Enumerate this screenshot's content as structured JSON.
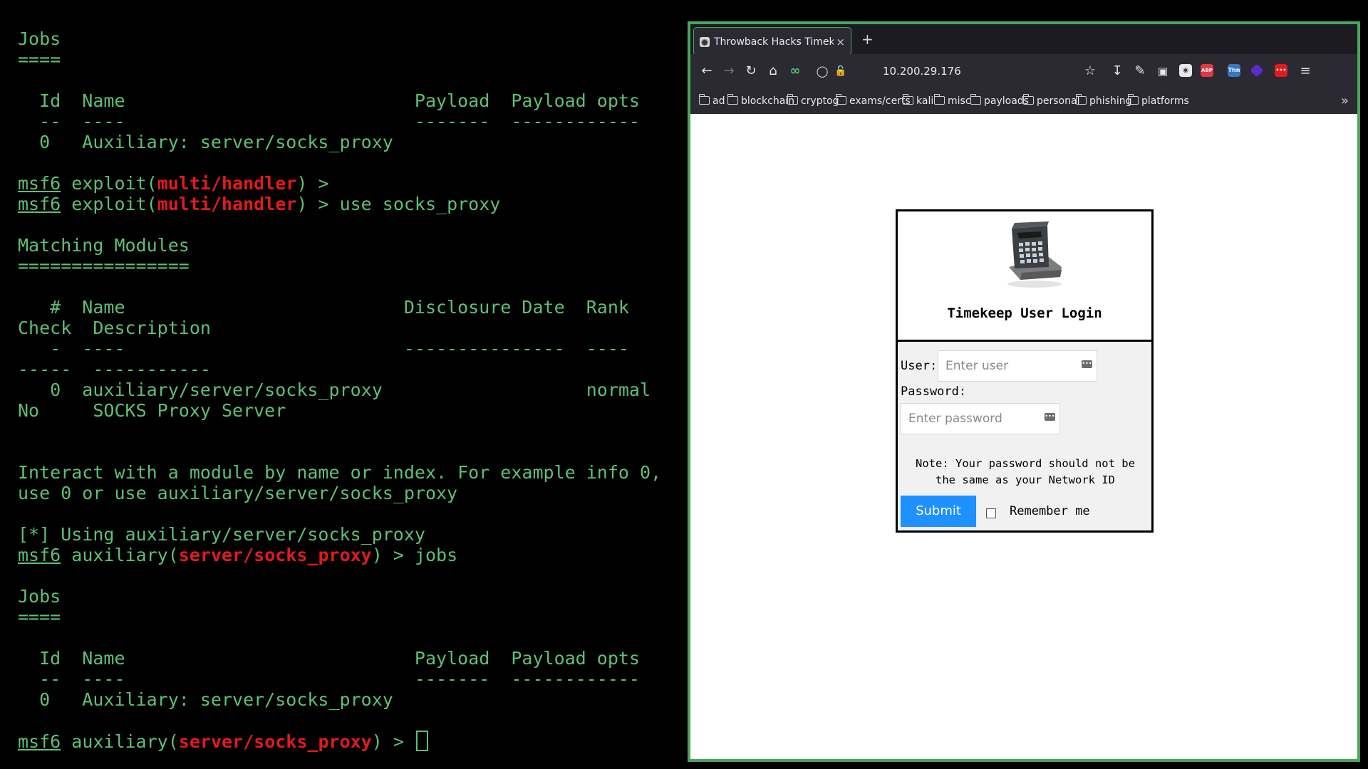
{
  "terminal": {
    "lines": [
      [
        {
          "t": "Jobs"
        }
      ],
      [
        {
          "t": "===="
        }
      ],
      [
        {
          "t": ""
        }
      ],
      [
        {
          "t": "  Id  Name                           Payload  Payload opts"
        }
      ],
      [
        {
          "t": "  --  ----                           -------  ------------"
        }
      ],
      [
        {
          "t": "  0   Auxiliary: server/socks_proxy"
        }
      ],
      [
        {
          "t": ""
        }
      ],
      [
        {
          "t": "msf6",
          "s": "ul"
        },
        {
          "t": " exploit("
        },
        {
          "t": "multi/handler",
          "s": "red"
        },
        {
          "t": ") >"
        }
      ],
      [
        {
          "t": "msf6",
          "s": "ul"
        },
        {
          "t": " exploit("
        },
        {
          "t": "multi/handler",
          "s": "red"
        },
        {
          "t": ") > use socks_proxy"
        }
      ],
      [
        {
          "t": ""
        }
      ],
      [
        {
          "t": "Matching Modules"
        }
      ],
      [
        {
          "t": "================"
        }
      ],
      [
        {
          "t": ""
        }
      ],
      [
        {
          "t": "   #  Name                          Disclosure Date  Rank"
        }
      ],
      [
        {
          "t": "Check  Description"
        }
      ],
      [
        {
          "t": "   -  ----                          ---------------  ----"
        }
      ],
      [
        {
          "t": "-----  -----------"
        }
      ],
      [
        {
          "t": "   0  auxiliary/server/socks_proxy                   normal"
        }
      ],
      [
        {
          "t": "No     SOCKS Proxy Server"
        }
      ],
      [
        {
          "t": ""
        }
      ],
      [
        {
          "t": ""
        }
      ],
      [
        {
          "t": "Interact with a module by name or index. For example info 0,"
        }
      ],
      [
        {
          "t": "use 0 or use auxiliary/server/socks_proxy"
        }
      ],
      [
        {
          "t": ""
        }
      ],
      [
        {
          "t": "[*] Using auxiliary/server/socks_proxy"
        }
      ],
      [
        {
          "t": "msf6",
          "s": "ul"
        },
        {
          "t": " auxiliary("
        },
        {
          "t": "server/socks_proxy",
          "s": "red"
        },
        {
          "t": ") > jobs"
        }
      ],
      [
        {
          "t": ""
        }
      ],
      [
        {
          "t": "Jobs"
        }
      ],
      [
        {
          "t": "===="
        }
      ],
      [
        {
          "t": ""
        }
      ],
      [
        {
          "t": "  Id  Name                           Payload  Payload opts"
        }
      ],
      [
        {
          "t": "  --  ----                           -------  ------------"
        }
      ],
      [
        {
          "t": "  0   Auxiliary: server/socks_proxy"
        }
      ],
      [
        {
          "t": ""
        }
      ],
      [
        {
          "t": "msf6",
          "s": "ul"
        },
        {
          "t": " auxiliary("
        },
        {
          "t": "server/socks_proxy",
          "s": "red"
        },
        {
          "t": ") > "
        },
        {
          "t": "",
          "s": "cursor"
        }
      ]
    ]
  },
  "browser": {
    "tab": {
      "title": "Throwback Hacks Timekeep",
      "close": "×"
    },
    "new_tab": "+",
    "url": "10.200.29.176",
    "extensions": [
      {
        "name": "ublock-icon",
        "label": "",
        "color": "#e8e8ec"
      },
      {
        "name": "abp-icon",
        "label": "ABP",
        "color": "#e4373f"
      },
      {
        "name": "thn-icon",
        "label": "Thn",
        "color": "#3577c3"
      },
      {
        "name": "gem-icon",
        "label": "",
        "color": "#5b2ccc"
      },
      {
        "name": "dots-ext-icon",
        "label": "•••",
        "color": "#e01b1b"
      }
    ],
    "bookmarks": [
      "ad",
      "blockchain",
      "cryptog",
      "exams/certs",
      "kali",
      "misc",
      "payloads",
      "personal",
      "phishing",
      "platforms"
    ],
    "bookmarks_overflow": "»"
  },
  "login": {
    "title": "Timekeep User Login",
    "user_label": "User:",
    "user_placeholder": "Enter user",
    "password_label": "Password:",
    "password_placeholder": "Enter password",
    "note_line1": "Note: Your password should not be",
    "note_line2": "the same as your Network ID",
    "submit": "Submit",
    "remember": "Remember me"
  }
}
